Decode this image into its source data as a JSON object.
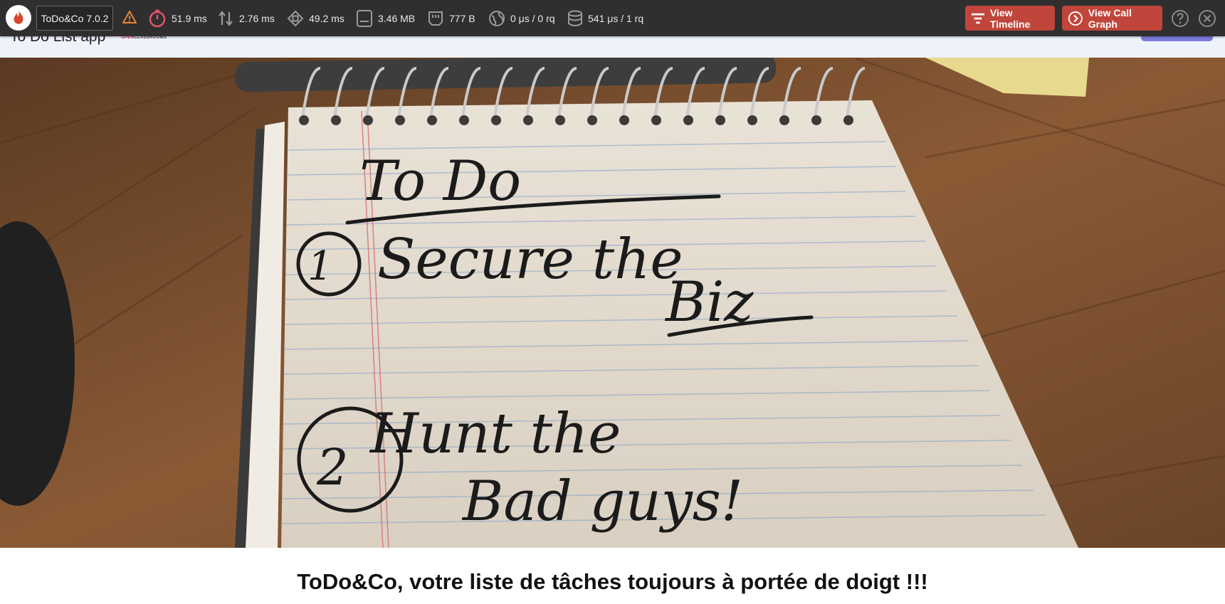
{
  "app_nav": {
    "brand": "To Do List app",
    "partner_logo_open": "OPEN",
    "partner_logo_rest": "CLASSROOMS"
  },
  "profiler": {
    "logo_icon": "flame-icon",
    "app_version": "ToDo&Co 7.0.2",
    "warning_icon": "warning-triangle-icon",
    "metrics": {
      "wall_time": "51.9 ms",
      "io_wait": "2.76 ms",
      "cpu_time": "49.2 ms",
      "memory": "3.46 MB",
      "network": "777 B",
      "http_requests": "0 μs / 0 rq",
      "sql_queries": "541 μs / 1 rq"
    },
    "buttons": {
      "timeline": "View Timeline",
      "call_graph": "View Call Graph"
    },
    "colors": {
      "bar_background": "#2f2f2f",
      "button": "#c0453a",
      "wall_time_icon": "#e2556b",
      "warning": "#e8862f"
    }
  },
  "hero": {
    "image_description_icon": "notepad-todo-image",
    "handwritten": {
      "title": "To Do",
      "item1": "Secure the",
      "item1b": "Biz",
      "item2a": "Hunt the",
      "item2b": "Bad guys!",
      "num1": "1",
      "num2": "2"
    }
  },
  "tagline": "ToDo&Co, votre liste de tâches toujours à portée de doigt !!!"
}
